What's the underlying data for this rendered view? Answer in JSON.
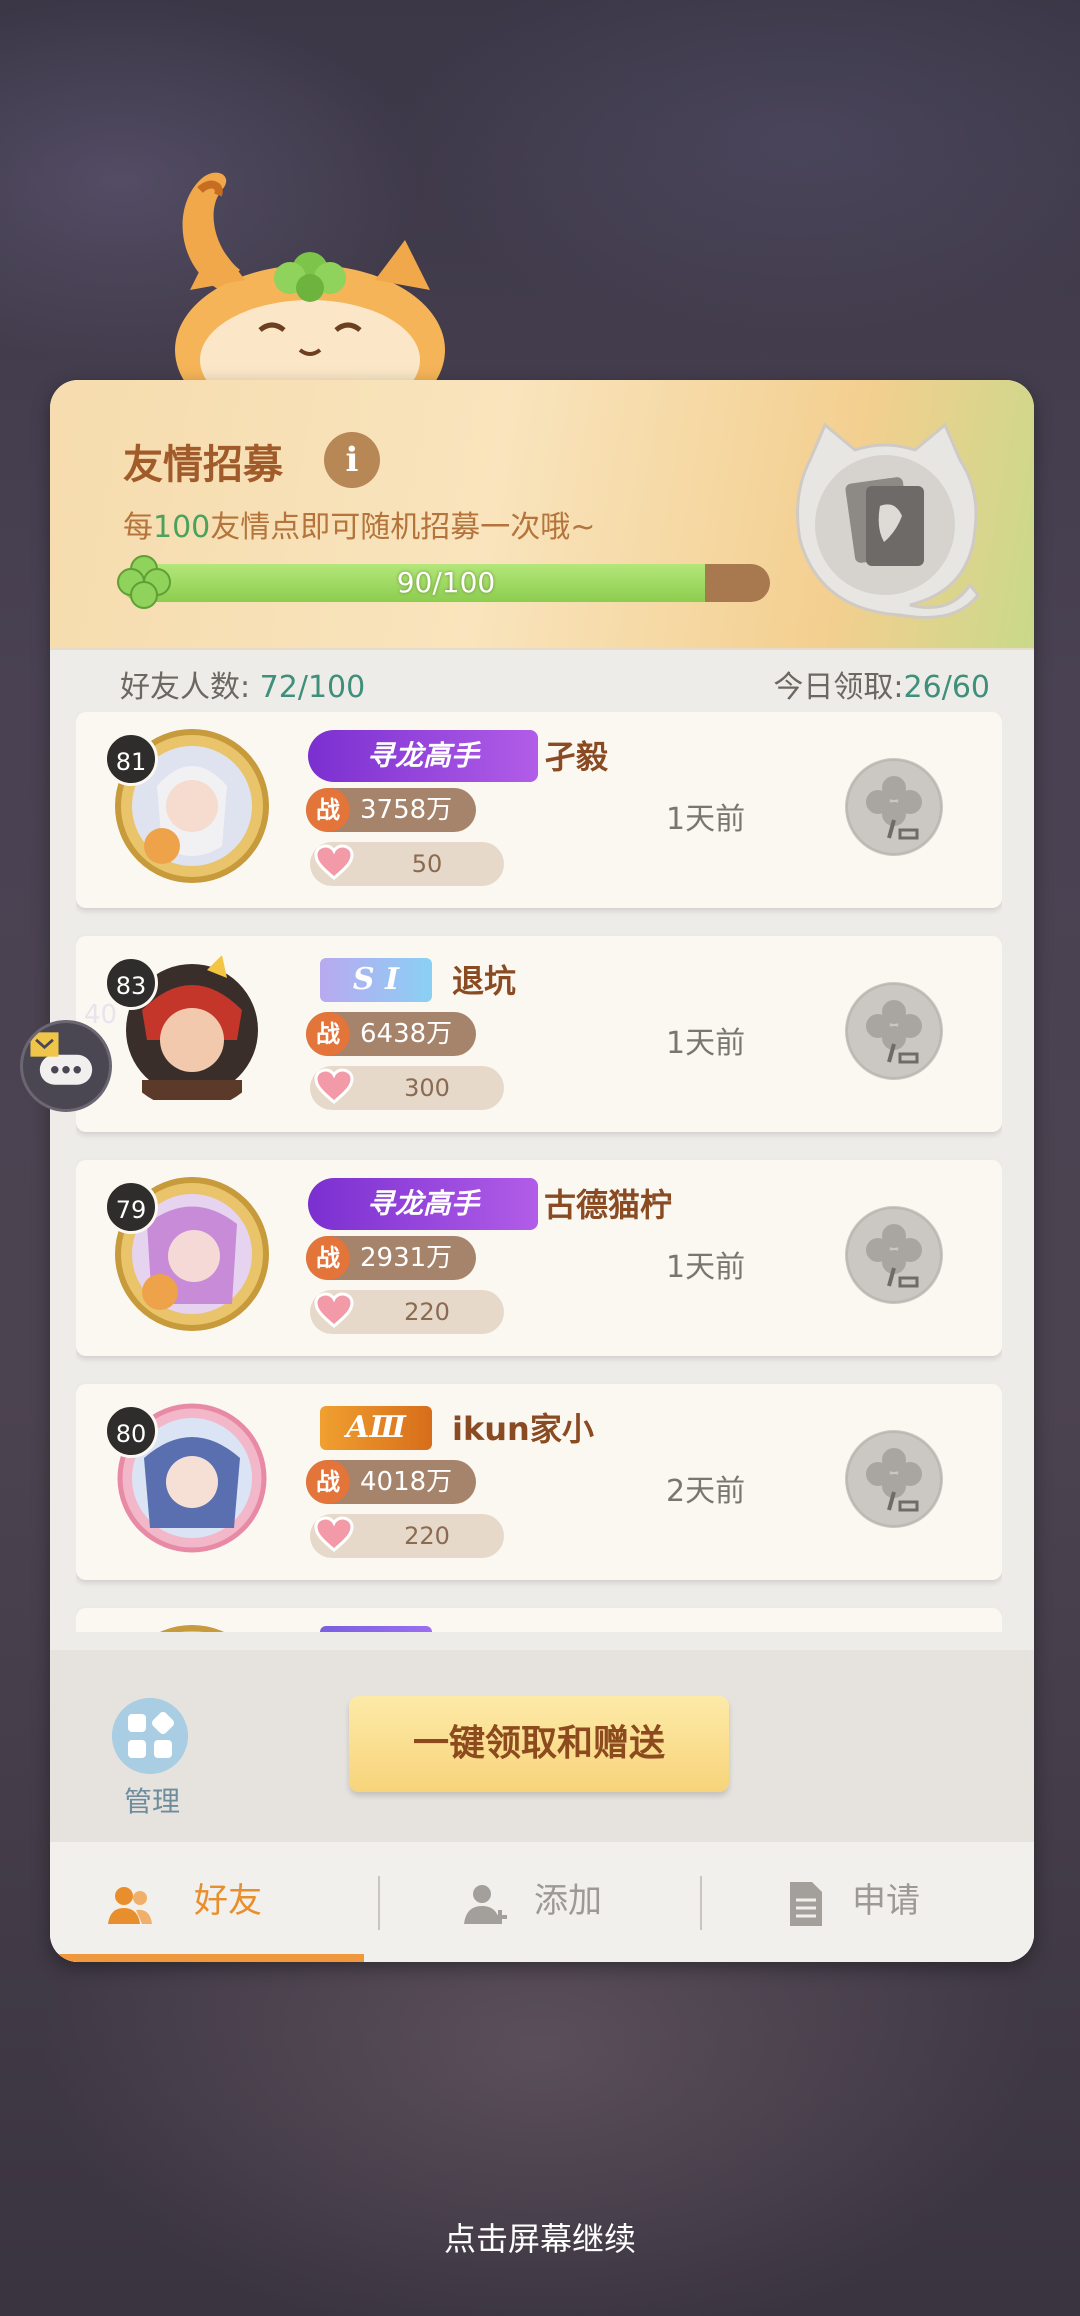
{
  "header": {
    "title": "友情招募",
    "desc_prefix": "每",
    "desc_highlight": "100",
    "desc_suffix": "友情点即可随机招募一次哦~",
    "progress_text": "90/100",
    "progress_fraction": 0.9
  },
  "stats": {
    "friends_label": "好友人数: ",
    "friends_value": "72/100",
    "today_label": "今日领取:",
    "today_value": "26/60"
  },
  "friends": [
    {
      "level": "81",
      "rank": "寻龙高手",
      "name": "孑毅",
      "power": "3758万",
      "power_tag": "战",
      "hearts": "50",
      "time": "1天前"
    },
    {
      "level": "83",
      "rank": "S I",
      "name": "退坑",
      "power": "6438万",
      "power_tag": "战",
      "hearts": "300",
      "time": "1天前"
    },
    {
      "level": "79",
      "rank": "寻龙高手",
      "name": "古德猫柠",
      "power": "2931万",
      "power_tag": "战",
      "hearts": "220",
      "time": "1天前"
    },
    {
      "level": "80",
      "rank": "AⅢ",
      "name": "ikun家小",
      "power": "4018万",
      "power_tag": "战",
      "hearts": "220",
      "time": "2天前"
    }
  ],
  "bottom": {
    "manage_label": "管理",
    "claim_button": "一键领取和赠送"
  },
  "tabs": [
    {
      "label": "好友",
      "icon": "friends-icon"
    },
    {
      "label": "添加",
      "icon": "add-friend-icon"
    },
    {
      "label": "申请",
      "icon": "document-icon"
    }
  ],
  "chat": {
    "count": "40"
  },
  "footer": {
    "continue": "点击屏幕继续"
  },
  "colors": {
    "accent": "#e88e2c",
    "title": "#a15b2a",
    "highlight": "#4aa25c"
  }
}
